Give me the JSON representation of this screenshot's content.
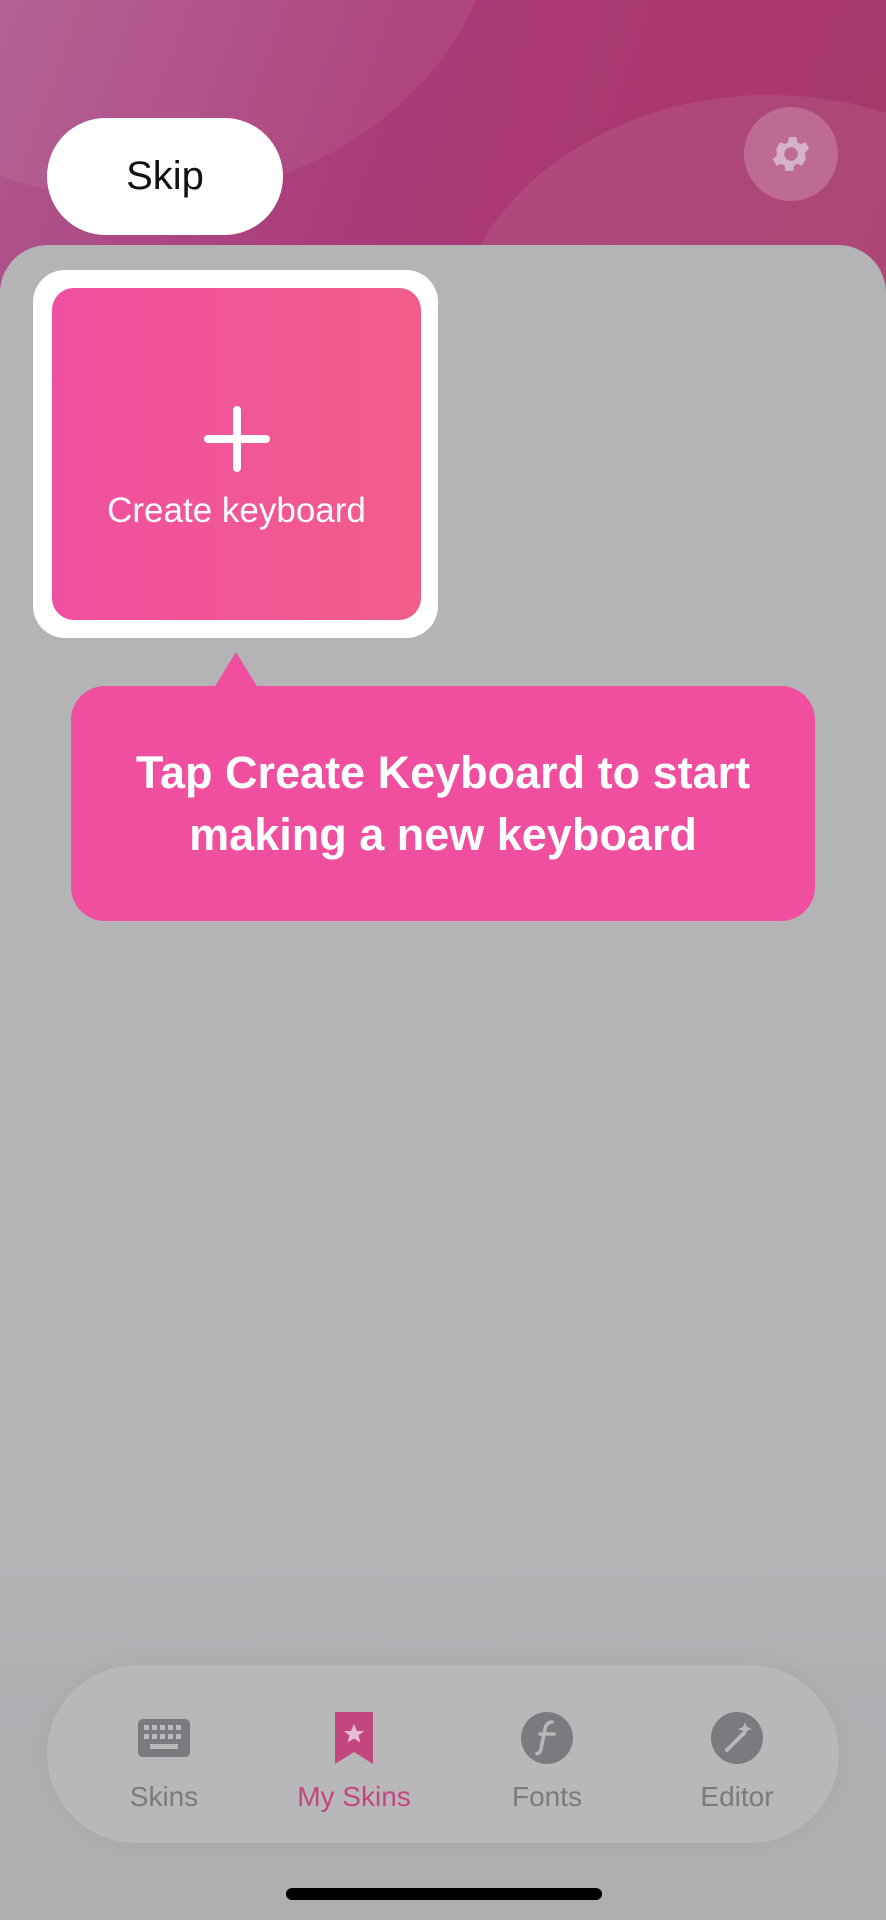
{
  "header": {
    "skip_label": "Skip",
    "settings_icon": "gear-icon"
  },
  "main": {
    "create_card": {
      "icon": "plus-icon",
      "label": "Create keyboard"
    },
    "tooltip": {
      "text": "Tap Create Keyboard to start making a new keyboard"
    }
  },
  "bottom_nav": {
    "items": [
      {
        "label": "Skins",
        "icon": "keyboard-icon",
        "active": false
      },
      {
        "label": "My Skins",
        "icon": "bookmark-star-icon",
        "active": true
      },
      {
        "label": "Fonts",
        "icon": "font-icon",
        "active": false
      },
      {
        "label": "Editor",
        "icon": "magic-wand-icon",
        "active": false
      }
    ]
  },
  "colors": {
    "accent": "#f04fa0",
    "active_tab": "#c4467f",
    "overlay": "#b4b3b6"
  }
}
